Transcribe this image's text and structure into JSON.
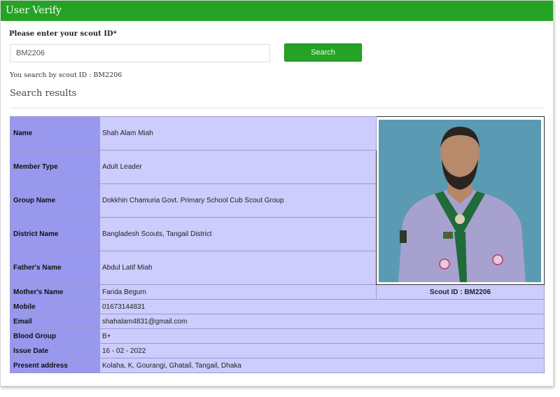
{
  "header": {
    "title": "User Verify"
  },
  "form": {
    "label": "Please enter your scout ID*",
    "input_value": "BM2206",
    "search_label": "Search",
    "search_note": "You search by scout ID : BM2206"
  },
  "results": {
    "title": "Search results",
    "scout_id_label": "Scout ID : BM2206",
    "rows": [
      {
        "key": "Name",
        "value": "Shah Alam Miah"
      },
      {
        "key": "Member Type",
        "value": "Adult Leader"
      },
      {
        "key": "Group Name",
        "value": "Dokkhin Chamuria Govt. Primary School Cub Scout Group"
      },
      {
        "key": "District Name",
        "value": "Bangladesh Scouts, Tangail District"
      },
      {
        "key": "Father's Name",
        "value": "Abdul Latif Miah"
      },
      {
        "key": "Mother's Name",
        "value": "Farida Begum"
      },
      {
        "key": "Mobile",
        "value": "01673144831"
      },
      {
        "key": "Email",
        "value": "shahalam4831@gmail.com"
      },
      {
        "key": "Blood Group",
        "value": "B+"
      },
      {
        "key": "Issue Date",
        "value": "16 - 02 - 2022"
      },
      {
        "key": "Present address",
        "value": "Kolaha, K, Gourangi, Ghatail, Tangail, Dhaka"
      }
    ]
  },
  "colors": {
    "header_green": "#24a324",
    "key_cell": "#9898ee",
    "value_cell": "#ccccfd",
    "photo_background": "#5a9ab2"
  }
}
